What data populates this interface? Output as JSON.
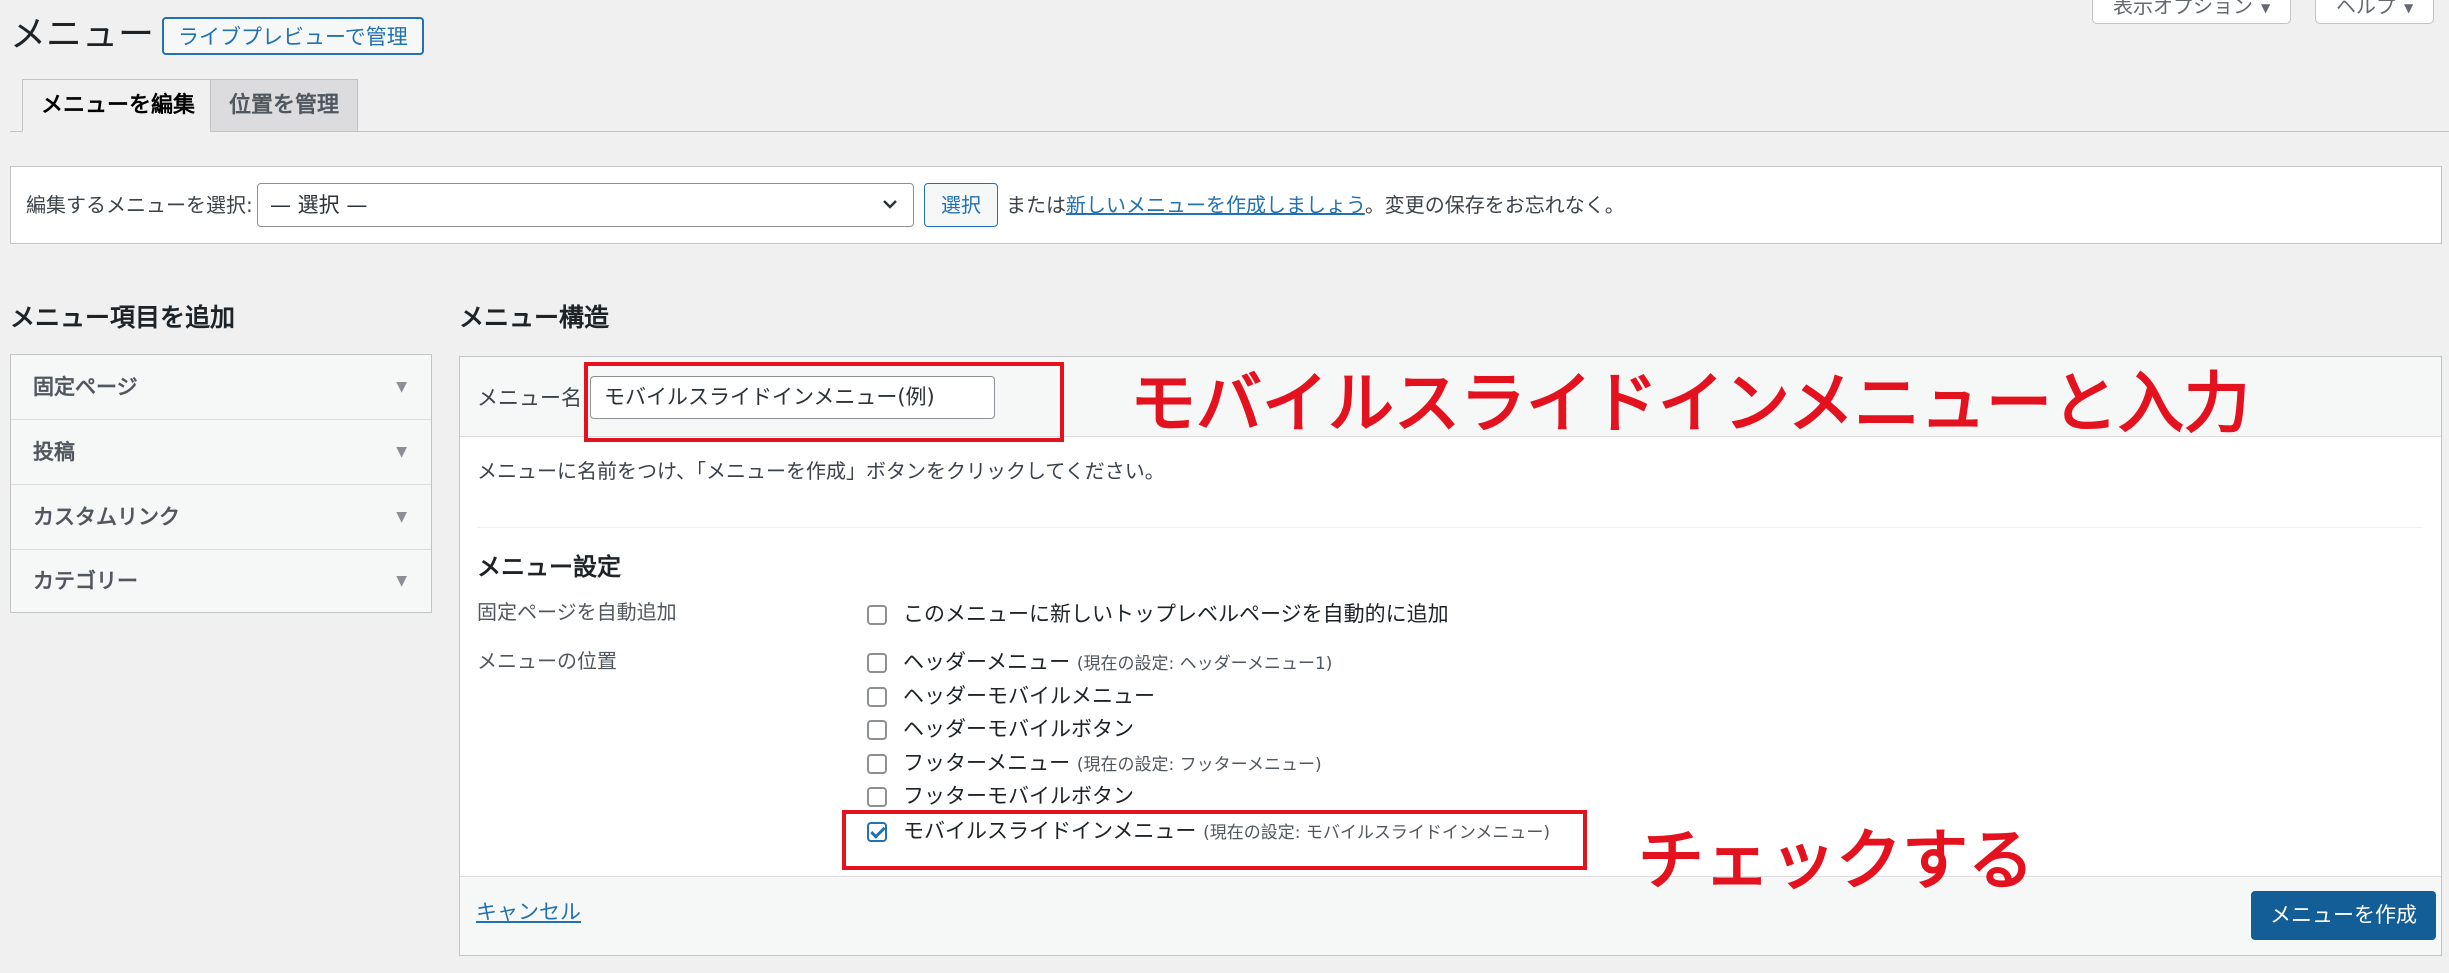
{
  "header": {
    "title": "メニュー",
    "live_preview_label": "ライブプレビューで管理",
    "screen_options_label": "表示オプション",
    "help_label": "ヘルプ"
  },
  "tabs": [
    {
      "label": "メニューを編集",
      "active": true
    },
    {
      "label": "位置を管理",
      "active": false
    }
  ],
  "select_bar": {
    "label": "編集するメニューを選択:",
    "selected_option": "— 選択 —",
    "select_button_label": "選択",
    "note_prefix": "または",
    "create_link_text": "新しいメニューを作成しましょう",
    "note_suffix": "。変更の保存をお忘れなく。"
  },
  "left": {
    "heading": "メニュー項目を追加",
    "items": [
      {
        "label": "固定ページ"
      },
      {
        "label": "投稿"
      },
      {
        "label": "カスタムリンク"
      },
      {
        "label": "カテゴリー"
      }
    ]
  },
  "right": {
    "heading": "メニュー構造",
    "menu_name_label": "メニュー名",
    "menu_name_value": "モバイルスライドインメニュー(例)",
    "hint": "メニューに名前をつけ、「メニューを作成」ボタンをクリックしてください。",
    "settings_heading": "メニュー設定",
    "auto_add_label": "固定ページを自動追加",
    "auto_add_option": "このメニューに新しいトップレベルページを自動的に追加",
    "location_label": "メニューの位置",
    "locations": [
      {
        "label": "ヘッダーメニュー",
        "note": "(現在の設定: ヘッダーメニュー1)",
        "checked": false
      },
      {
        "label": "ヘッダーモバイルメニュー",
        "note": "",
        "checked": false
      },
      {
        "label": "ヘッダーモバイルボタン",
        "note": "",
        "checked": false
      },
      {
        "label": "フッターメニュー",
        "note": "(現在の設定: フッターメニュー)",
        "checked": false
      },
      {
        "label": "フッターモバイルボタン",
        "note": "",
        "checked": false
      },
      {
        "label": "モバイルスライドインメニュー",
        "note": "(現在の設定: モバイルスライドインメニュー)",
        "checked": true
      }
    ],
    "cancel_label": "キャンセル",
    "create_button_label": "メニューを作成"
  },
  "annotations": {
    "name_instruction": "モバイルスライドインメニューと入力",
    "check_instruction": "チェックする"
  },
  "colors": {
    "accent": "#2271b1",
    "primary_button": "#135e96",
    "annotation_red": "#e4121e",
    "background": "#f0f0f1"
  }
}
